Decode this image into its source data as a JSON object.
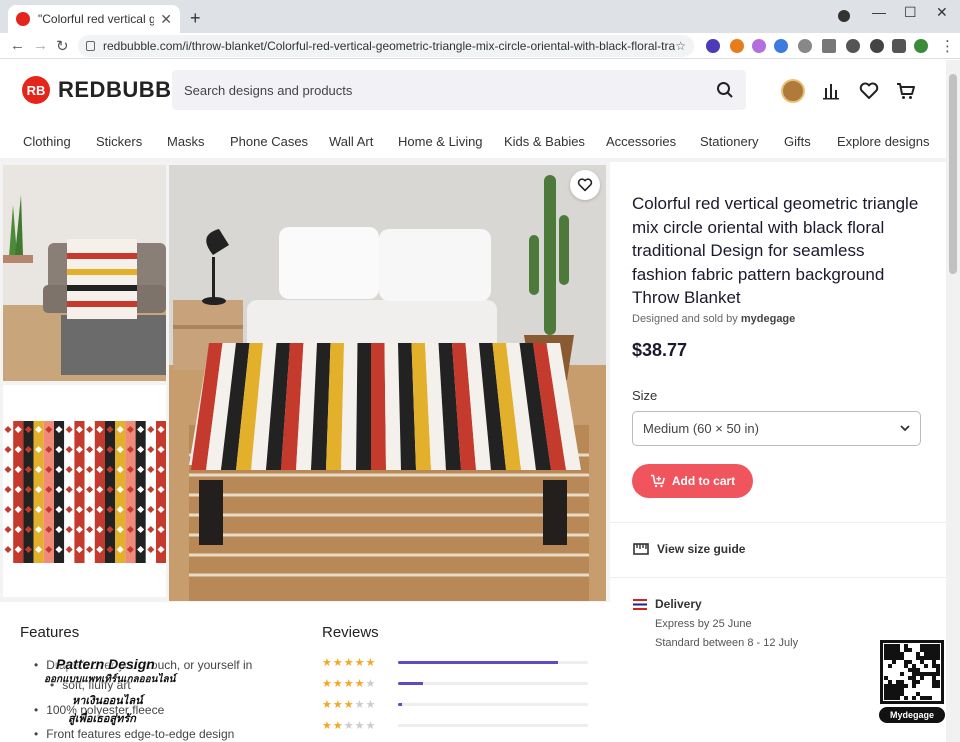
{
  "browser": {
    "tab_title": "\"Colorful red vertical geometric t",
    "new_tab": "+",
    "back": "←",
    "forward": "→",
    "reload": "↻",
    "url": "redbubble.com/i/throw-blanket/Colorful-red-vertical-geometric-triangle-mix-circle-oriental-with-black-floral-traditional-D...",
    "bookmark": "☆",
    "minimize": "—",
    "maximize": "☐",
    "close": "✕",
    "menu": "⋮"
  },
  "site": {
    "logo_text": "REDBUBBLE",
    "logo_mark": "RB",
    "search_placeholder": "Search designs and products"
  },
  "categories": [
    "Clothing",
    "Stickers",
    "Masks",
    "Phone Cases",
    "Wall Art",
    "Home & Living",
    "Kids & Babies",
    "Accessories",
    "Stationery",
    "Gifts",
    "Explore designs"
  ],
  "product": {
    "title": "Colorful red vertical geometric triangle mix circle oriental with black floral traditional Design for seamless fashion fabric pattern background Throw Blanket",
    "designed_by_prefix": "Designed and sold by",
    "designer": "mydegage",
    "price": "$38.77",
    "size_label": "Size",
    "size_value": "Medium (60 × 50 in)",
    "add_to_cart": "Add to cart",
    "size_guide": "View size guide",
    "delivery_title": "Delivery",
    "delivery_express": "Express by 25 June",
    "delivery_standard": "Standard between 8 - 12 July"
  },
  "features": {
    "heading": "Features",
    "items": [
      "Drape it over your couch, or yourself in",
      "soft, fluffy art",
      "100% polyester fleece",
      "Front features edge-to-edge design"
    ]
  },
  "reviews": {
    "heading": "Reviews",
    "rows": [
      {
        "stars": 5,
        "fill": 0.84
      },
      {
        "stars": 4,
        "fill": 0.13
      },
      {
        "stars": 3,
        "fill": 0.02
      },
      {
        "stars": 2,
        "fill": 0.0
      }
    ]
  },
  "overlay": {
    "line1": "Pattern Design",
    "line2": "ออกแบบแพทเทิร์นเกลออนไลน์",
    "line3": "หาเงินออนไลน์",
    "line4": "สู่เพื่อเธอสู่ทรัก"
  },
  "qr_label": "Mydegage",
  "colors": {
    "brand_red": "#e4251b",
    "cart_button": "#f0545c",
    "review_bar": "#5b4cc6",
    "star": "#f5a623"
  }
}
